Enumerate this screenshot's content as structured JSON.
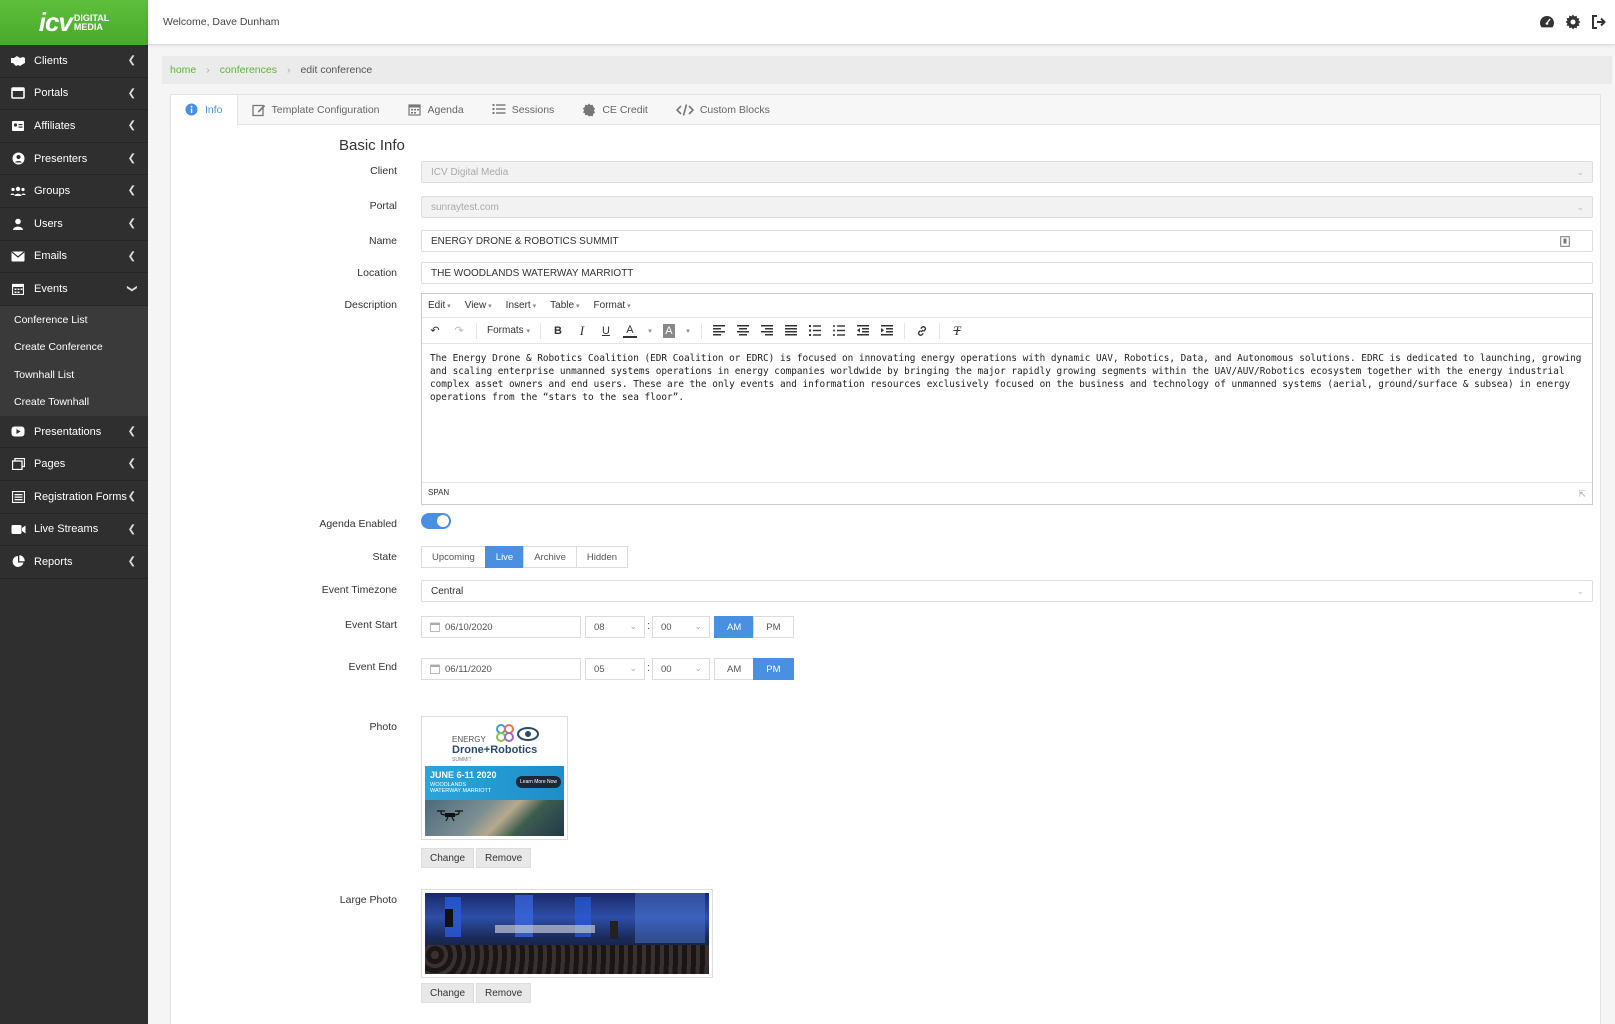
{
  "app": {
    "logo_main": "icv",
    "logo_sub_1": "DIGITAL",
    "logo_sub_2": "MEDIA",
    "welcome": "Welcome, Dave Dunham"
  },
  "sidebar": {
    "items": [
      {
        "label": "Clients",
        "icon": "handshake-icon"
      },
      {
        "label": "Portals",
        "icon": "window-icon"
      },
      {
        "label": "Affiliates",
        "icon": "id-card-icon"
      },
      {
        "label": "Presenters",
        "icon": "user-circle-icon"
      },
      {
        "label": "Groups",
        "icon": "users-icon"
      },
      {
        "label": "Users",
        "icon": "user-icon"
      },
      {
        "label": "Emails",
        "icon": "envelope-icon"
      },
      {
        "label": "Events",
        "icon": "calendar-icon"
      }
    ],
    "events_sub": [
      "Conference List",
      "Create Conference",
      "Townhall List",
      "Create Townhall"
    ],
    "items_after": [
      {
        "label": "Presentations",
        "icon": "youtube-icon"
      },
      {
        "label": "Pages",
        "icon": "copy-icon"
      },
      {
        "label": "Registration Forms",
        "icon": "list-icon"
      },
      {
        "label": "Live Streams",
        "icon": "video-icon"
      },
      {
        "label": "Reports",
        "icon": "pie-chart-icon"
      }
    ]
  },
  "breadcrumb": {
    "home": "home",
    "conferences": "conferences",
    "current": "edit conference"
  },
  "tabs": [
    "Info",
    "Template Configuration",
    "Agenda",
    "Sessions",
    "CE Credit",
    "Custom Blocks"
  ],
  "form": {
    "section_title": "Basic Info",
    "client_label": "Client",
    "client_value": "ICV Digital Media",
    "portal_label": "Portal",
    "portal_value": "sunraytest.com",
    "name_label": "Name",
    "name_value": "ENERGY DRONE & ROBOTICS SUMMIT",
    "location_label": "Location",
    "location_value": "THE WOODLANDS WATERWAY MARRIOTT",
    "description_label": "Description",
    "editor_menu": [
      "Edit",
      "View",
      "Insert",
      "Table",
      "Format"
    ],
    "editor_formats": "Formats",
    "description_text": "The Energy Drone & Robotics Coalition (EDR Coalition or EDRC) is focused on innovating energy operations with dynamic UAV, Robotics, Data, and Autonomous solutions. EDRC is dedicated to launching, growing and scaling enterprise unmanned systems operations in energy companies worldwide by bringing the major rapidly growing segments within the UAV/AUV/Robotics ecosystem together with the energy industrial complex asset owners and end users. These are the only events and information resources exclusively focused on the business and technology of unmanned systems (aerial, ground/surface & subsea) in energy operations from the “stars to the sea floor”.",
    "editor_status": "SPAN",
    "agenda_label": "Agenda Enabled",
    "agenda_enabled": true,
    "state_label": "State",
    "state_options": [
      "Upcoming",
      "Live",
      "Archive",
      "Hidden"
    ],
    "state_selected": "Live",
    "timezone_label": "Event Timezone",
    "timezone_value": "Central",
    "start_label": "Event Start",
    "start_date": "06/10/2020",
    "start_hour": "08",
    "start_min": "00",
    "start_ampm": "AM",
    "end_label": "Event End",
    "end_date": "06/11/2020",
    "end_hour": "05",
    "end_min": "00",
    "end_ampm": "PM",
    "am": "AM",
    "pm": "PM",
    "photo_label": "Photo",
    "photo_text": {
      "energy": "ENERGY",
      "title": "Drone+Robotics",
      "summit": "SUMMIT",
      "dates": "JUNE 6-11 2020",
      "venue_1": "WOODLANDS",
      "venue_2": "WATERWAY MARRIOTT",
      "cta": "Learn More Now"
    },
    "large_photo_label": "Large Photo",
    "change": "Change",
    "remove": "Remove"
  },
  "colors": {
    "brand_green": "#5ebf3c",
    "accent_blue": "#4a90e2",
    "sidebar_bg": "#2f2f2f"
  }
}
